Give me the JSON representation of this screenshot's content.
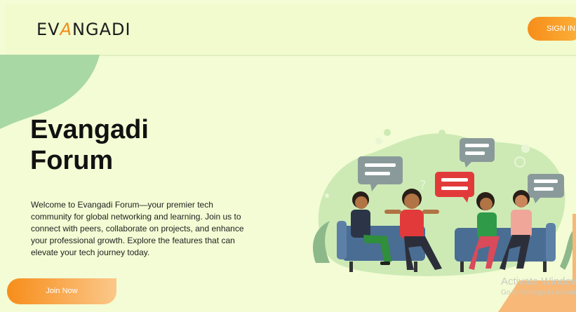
{
  "header": {
    "logo_left": "EV",
    "logo_accent": "A",
    "logo_right": "NGADI",
    "signin_label": "SIGN IN"
  },
  "hero": {
    "title_line1": "Evangadi",
    "title_line2": "Forum",
    "description": "Welcome to Evangadi Forum—your premier tech community for global networking and learning. Join us to connect with peers, collaborate on projects, and enhance your professional growth. Explore the features that can elevate your tech journey today.",
    "join_label": "Join Now"
  },
  "watermark": {
    "line1": "Activate Windows",
    "line2": "Go to Settings to activate Windows."
  },
  "colors": {
    "accent": "#f78d1a",
    "background": "#f3fcd4",
    "blob": "#a8d8a4"
  }
}
